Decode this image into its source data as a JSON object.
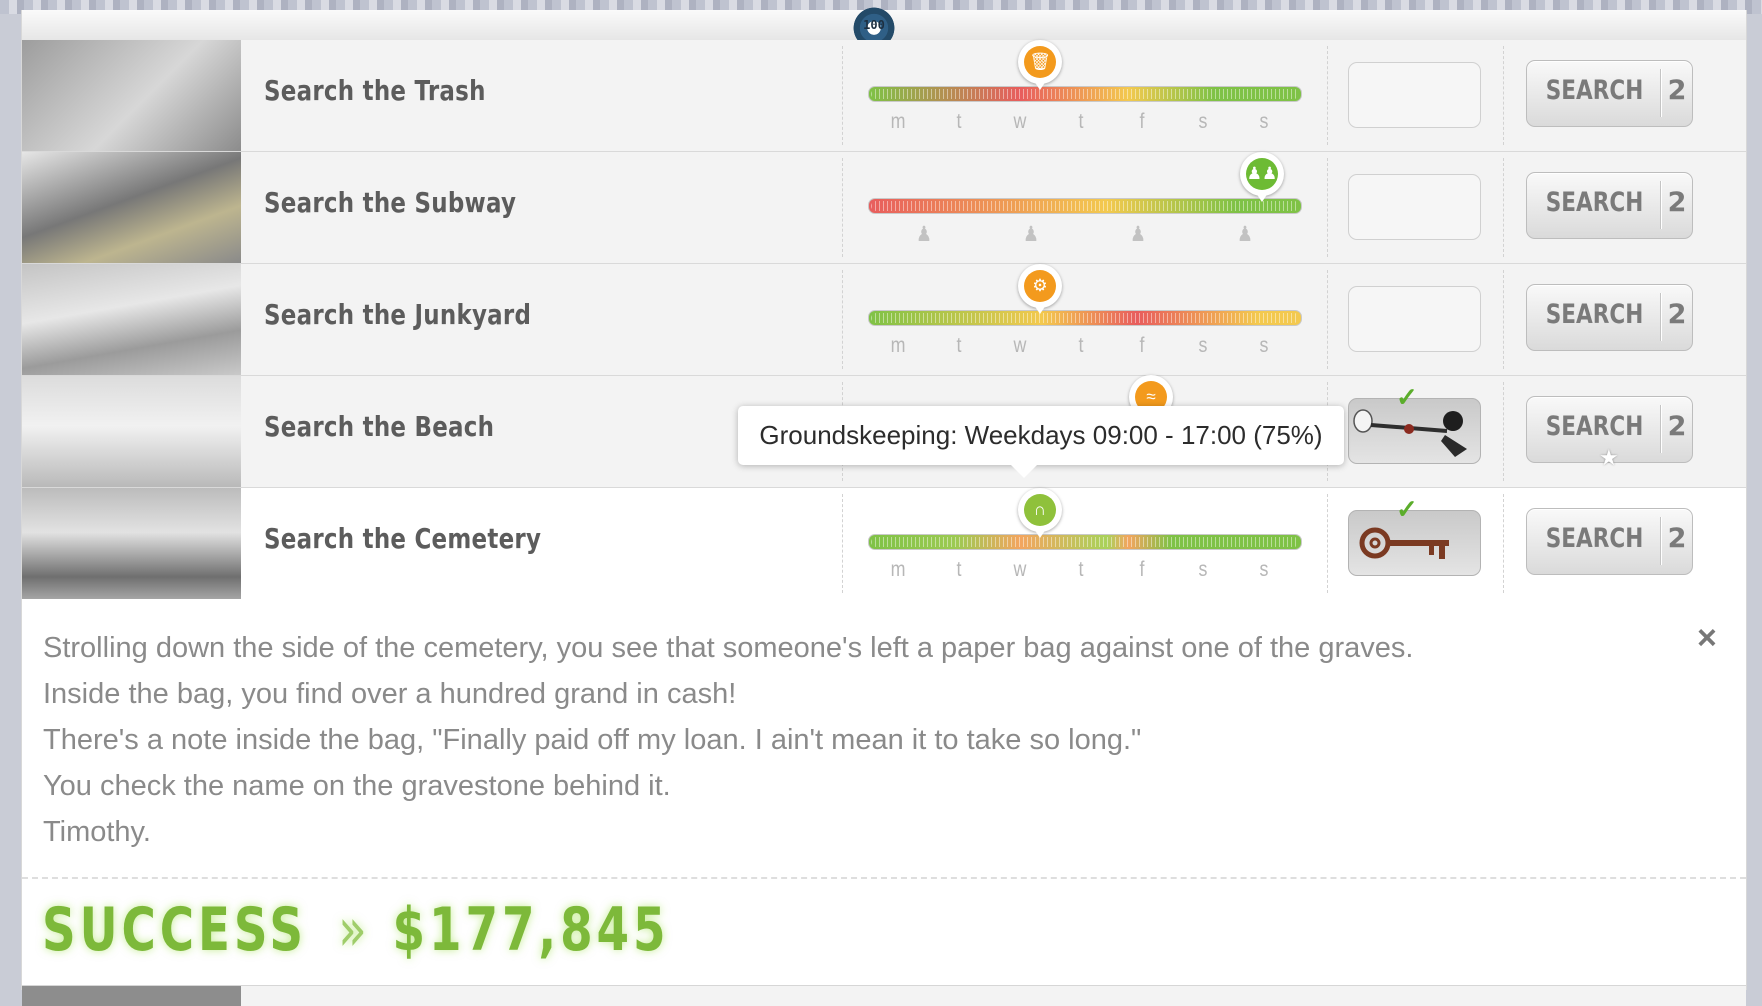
{
  "level_badge": "100",
  "day_labels": [
    "m",
    "t",
    "w",
    "t",
    "f",
    "s",
    "s"
  ],
  "rows": [
    {
      "title": "Search the Trash",
      "pin_icon": "trash-icon",
      "pin_color": "#f39a1d",
      "bar_gradient": [
        "#7fc246",
        "#e85d5d",
        "#f3c94f",
        "#7fc246"
      ],
      "axis": "days",
      "slot_item": "",
      "button_label": "SEARCH",
      "button_count": "2"
    },
    {
      "title": "Search the Subway",
      "pin_icon": "crowd-icon",
      "pin_color": "#6dbb34",
      "bar_gradient": [
        "#e85d5d",
        "#f3c94f",
        "#7fc246"
      ],
      "axis": "crowd",
      "slot_item": "",
      "button_label": "SEARCH",
      "button_count": "2"
    },
    {
      "title": "Search the Junkyard",
      "pin_icon": "junk-icon",
      "pin_color": "#f39a1d",
      "bar_gradient": [
        "#7fc246",
        "#f3c94f",
        "#e85d5d",
        "#f3c94f"
      ],
      "axis": "days",
      "slot_item": "",
      "button_label": "SEARCH",
      "button_count": "2"
    },
    {
      "title": "Search the Beach",
      "pin_icon": "waves-icon",
      "pin_color": "#f39a1d",
      "bar_gradient": [
        "#f3c94f",
        "#7fc246"
      ],
      "axis": "days",
      "slot_item": "metal-detector-icon",
      "slot_checked": true,
      "button_label": "SEARCH",
      "button_count": "2",
      "button_star": true
    },
    {
      "title": "Search the Cemetery",
      "pin_icon": "tombstone-icon",
      "pin_color": "#8fc13b",
      "bar_gradient": [
        "#7fc246",
        "#f3a55f",
        "#7fc246"
      ],
      "axis": "days",
      "slot_item": "key-icon",
      "slot_checked": true,
      "button_label": "SEARCH",
      "button_count": "2"
    }
  ],
  "tooltip": "Groundskeeping: Weekdays 09:00 - 17:00 (75%)",
  "story": {
    "lines": [
      "Strolling down the side of the cemetery, you see that someone's left a paper bag against one of the graves.",
      "Inside the bag, you find over a hundred grand in cash!",
      "There's a note inside the bag, \"Finally paid off my loan. I ain't mean it to take so long.\"",
      "You check the name on the gravestone behind it.",
      "Timothy."
    ],
    "close_label": "×",
    "result_label": "SUCCESS",
    "separator": "»",
    "amount": "$177,845"
  }
}
